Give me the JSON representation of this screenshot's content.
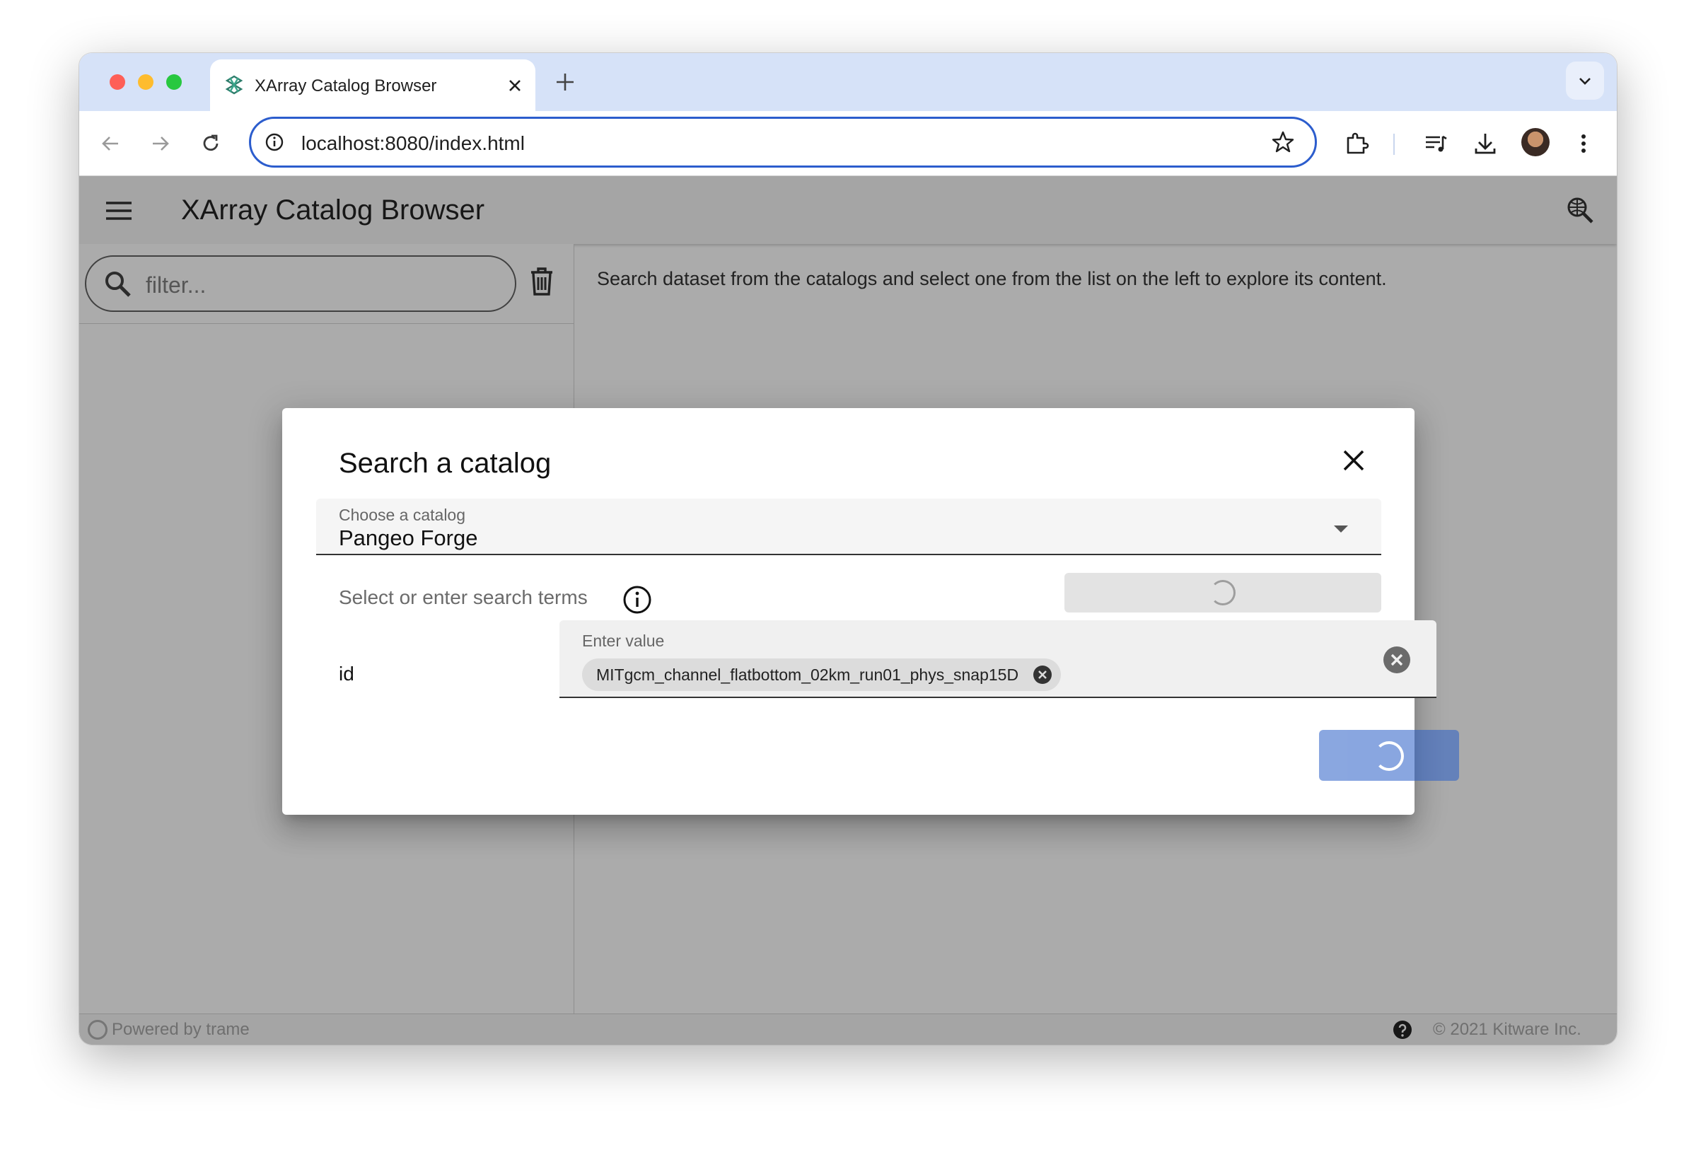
{
  "browser": {
    "tab_title": "XArray Catalog Browser",
    "url": "localhost:8080/index.html"
  },
  "app": {
    "title": "XArray Catalog Browser",
    "filter_placeholder": "filter...",
    "main_message": "Search dataset from the catalogs and select one from the list on the left to explore its content.",
    "footer_powered": "Powered by trame",
    "footer_copyright": "© 2021 Kitware Inc."
  },
  "dialog": {
    "title": "Search a catalog",
    "catalog_label": "Choose a catalog",
    "catalog_value": "Pangeo Forge",
    "terms_label": "Select or enter search terms",
    "term_name": "id",
    "value_label": "Enter value",
    "chips": [
      "MITgcm_channel_flatbottom_02km_run01_phys_snap15D"
    ]
  },
  "colors": {
    "accent": "#2c5dcd",
    "submit_button": "#2a5ec7",
    "overlay": "rgba(33,33,33,0.38)"
  },
  "icons": [
    "trame-favicon",
    "close-icon",
    "plus-icon",
    "chevron-down-icon",
    "back-arrow-icon",
    "forward-arrow-icon",
    "reload-icon",
    "info-icon",
    "star-icon",
    "extensions-icon",
    "media-icon",
    "download-icon",
    "avatar",
    "more-vert-icon",
    "hamburger-icon",
    "globe-search-icon",
    "search-icon",
    "trash-icon",
    "help-icon",
    "spinner-icon",
    "clear-icon"
  ]
}
